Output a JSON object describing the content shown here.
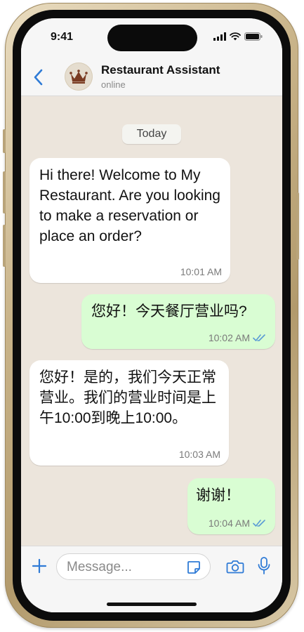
{
  "status_bar": {
    "time": "9:41"
  },
  "header": {
    "back_icon": "chevron-left-icon",
    "contact_name": "Restaurant Assistant",
    "contact_status": "online",
    "avatar_icon": "crown-icon"
  },
  "chat": {
    "date_label": "Today",
    "messages": [
      {
        "direction": "incoming",
        "text": "Hi there! Welcome to My Restaurant. Are you looking to make a reservation or place an order?",
        "time": "10:01 AM"
      },
      {
        "direction": "outgoing",
        "text": "您好！今天餐厅营业吗?",
        "time": "10:02 AM",
        "read_icon": "double-check-icon"
      },
      {
        "direction": "incoming",
        "text": "您好！是的，我们今天正常营业。我们的营业时间是上午10:00到晚上10:00。",
        "time": "10:03 AM"
      },
      {
        "direction": "outgoing",
        "text": "谢谢！",
        "time": "10:04 AM",
        "read_icon": "double-check-icon"
      }
    ]
  },
  "input_bar": {
    "placeholder": "Message...",
    "icons": [
      "plus-icon",
      "sticker-icon",
      "camera-icon",
      "microphone-icon"
    ]
  },
  "colors": {
    "accent": "#2f7bd6",
    "outgoing_bubble": "#d9fdd3",
    "incoming_bubble": "#ffffff",
    "chat_background": "#ece5dc",
    "read_ticks": "#5a9bd5"
  }
}
